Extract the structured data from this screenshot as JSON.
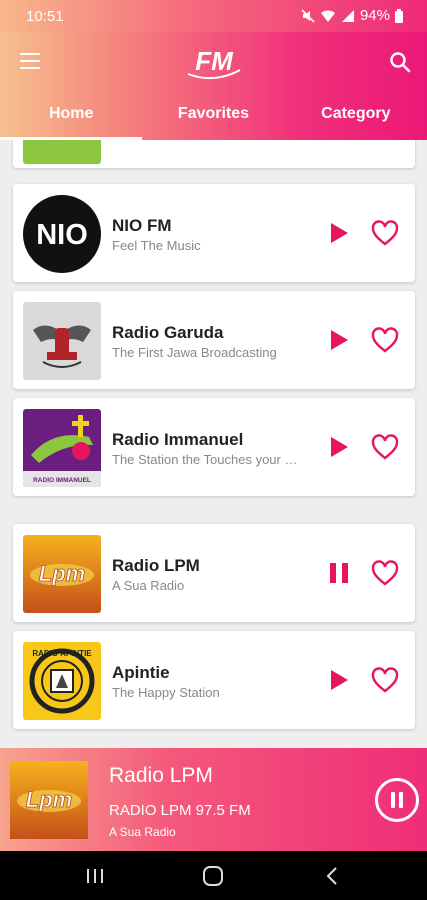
{
  "status_bar": {
    "time": "10:51",
    "battery": "94%"
  },
  "app_bar": {
    "logo_text": "FM",
    "tabs": [
      {
        "label": "Home",
        "active": true
      },
      {
        "label": "Favorites",
        "active": false
      },
      {
        "label": "Category",
        "active": false
      }
    ]
  },
  "stations": [
    {
      "name": "NIO FM",
      "tagline": "Feel The Music",
      "logo_text": "NIO",
      "state": "play"
    },
    {
      "name": "Radio Garuda",
      "tagline": "The First Jawa Broadcasting",
      "logo_text": "",
      "state": "play"
    },
    {
      "name": "Radio Immanuel",
      "tagline": "The Station the Touches your …",
      "logo_text": "RADIO IMMANUEL",
      "state": "play"
    },
    {
      "name": "Radio LPM",
      "tagline": "A Sua Radio",
      "logo_text": "Lpm",
      "state": "pause"
    },
    {
      "name": "Apintie",
      "tagline": "The Happy Station",
      "logo_text": "RADIO APINTIE",
      "state": "play"
    }
  ],
  "now_playing": {
    "name": "Radio LPM",
    "subtitle": "RADIO LPM 97.5 FM",
    "tagline": "A Sua Radio",
    "logo_text": "Lpm"
  },
  "colors": {
    "accent": "#ec1877",
    "gradient_start": "#f6c08e"
  },
  "icons": [
    "menu-icon",
    "search-icon",
    "play-icon",
    "pause-icon",
    "heart-icon",
    "mute-icon",
    "wifi-icon",
    "signal-icon",
    "battery-icon",
    "recents-icon",
    "home-icon",
    "back-icon"
  ]
}
